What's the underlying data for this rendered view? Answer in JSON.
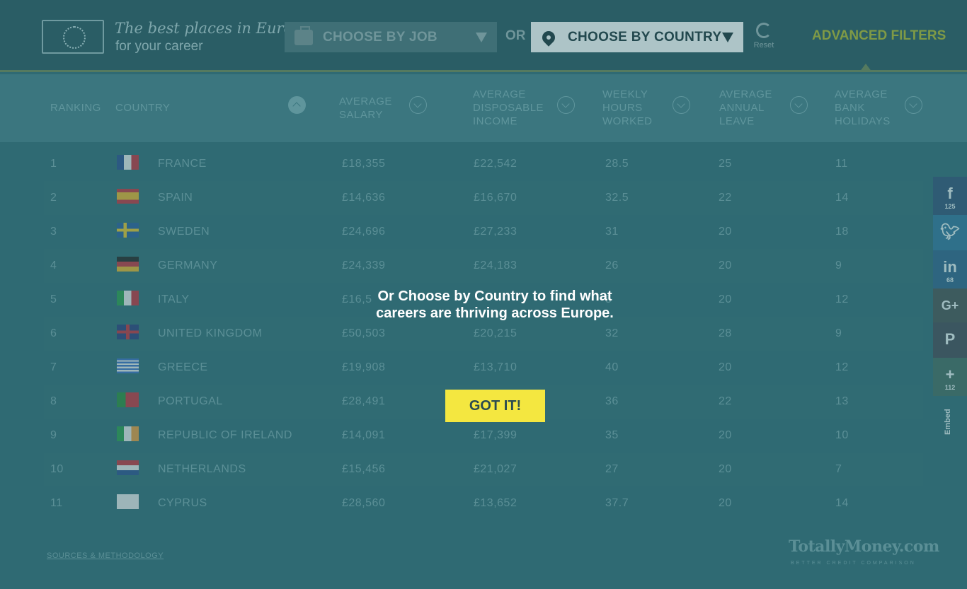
{
  "header": {
    "logo_line1": "The best places in Europe",
    "logo_line2": "for your career",
    "job_select": "CHOOSE BY JOB",
    "or_text": "OR",
    "country_select": "CHOOSE BY COUNTRY",
    "reset_label": "Reset",
    "advanced_filters": "ADVANCED FILTERS"
  },
  "table": {
    "columns": [
      "RANKING",
      "COUNTRY",
      "AVERAGE SALARY",
      "AVERAGE DISPOSABLE INCOME",
      "WEEKLY HOURS WORKED",
      "AVERAGE ANNUAL LEAVE",
      "AVERAGE BANK HOLIDAYS"
    ],
    "rows": [
      {
        "rank": "1",
        "country": "FRANCE",
        "salary": "£18,355",
        "disposable": "£22,542",
        "hours": "28.5",
        "leave": "25",
        "holidays": "11"
      },
      {
        "rank": "2",
        "country": "SPAIN",
        "salary": "£14,636",
        "disposable": "£16,670",
        "hours": "32.5",
        "leave": "22",
        "holidays": "14"
      },
      {
        "rank": "3",
        "country": "SWEDEN",
        "salary": "£24,696",
        "disposable": "£27,233",
        "hours": "31",
        "leave": "20",
        "holidays": "18"
      },
      {
        "rank": "4",
        "country": "GERMANY",
        "salary": "£24,339",
        "disposable": "£24,183",
        "hours": "26",
        "leave": "20",
        "holidays": "9"
      },
      {
        "rank": "5",
        "country": "ITALY",
        "salary": "£16,5",
        "disposable": "",
        "hours": "5",
        "leave": "20",
        "holidays": "12"
      },
      {
        "rank": "6",
        "country": "UNITED KINGDOM",
        "salary": "£50,503",
        "disposable": "£20,215",
        "hours": "32",
        "leave": "28",
        "holidays": "9"
      },
      {
        "rank": "7",
        "country": "GREECE",
        "salary": "£19,908",
        "disposable": "£13,710",
        "hours": "40",
        "leave": "20",
        "holidays": "12"
      },
      {
        "rank": "8",
        "country": "PORTUGAL",
        "salary": "£28,491",
        "disposable": "",
        "hours": "36",
        "leave": "22",
        "holidays": "13"
      },
      {
        "rank": "9",
        "country": "REPUBLIC OF IRELAND",
        "salary": "£14,091",
        "disposable": "£17,399",
        "hours": "35",
        "leave": "20",
        "holidays": "10"
      },
      {
        "rank": "10",
        "country": "NETHERLANDS",
        "salary": "£15,456",
        "disposable": "£21,027",
        "hours": "27",
        "leave": "20",
        "holidays": "7"
      },
      {
        "rank": "11",
        "country": "CYPRUS",
        "salary": "£28,560",
        "disposable": "£13,652",
        "hours": "37.7",
        "leave": "20",
        "holidays": "14"
      }
    ]
  },
  "footer": {
    "sources": "SOURCES & METHODOLOGY",
    "brand": "TotallyMoney.com",
    "brand_tagline": "BETTER CREDIT COMPARISON"
  },
  "social": {
    "facebook_count": "125",
    "linkedin_count": "68",
    "more_count": "112",
    "embed": "Embed"
  },
  "overlay": {
    "message": "Or Choose by Country to find what careers are thriving across Europe.",
    "button": "GOT IT!"
  },
  "colors": {
    "highlight_button": "#f4e740",
    "advanced_filters": "#7f9a46"
  }
}
